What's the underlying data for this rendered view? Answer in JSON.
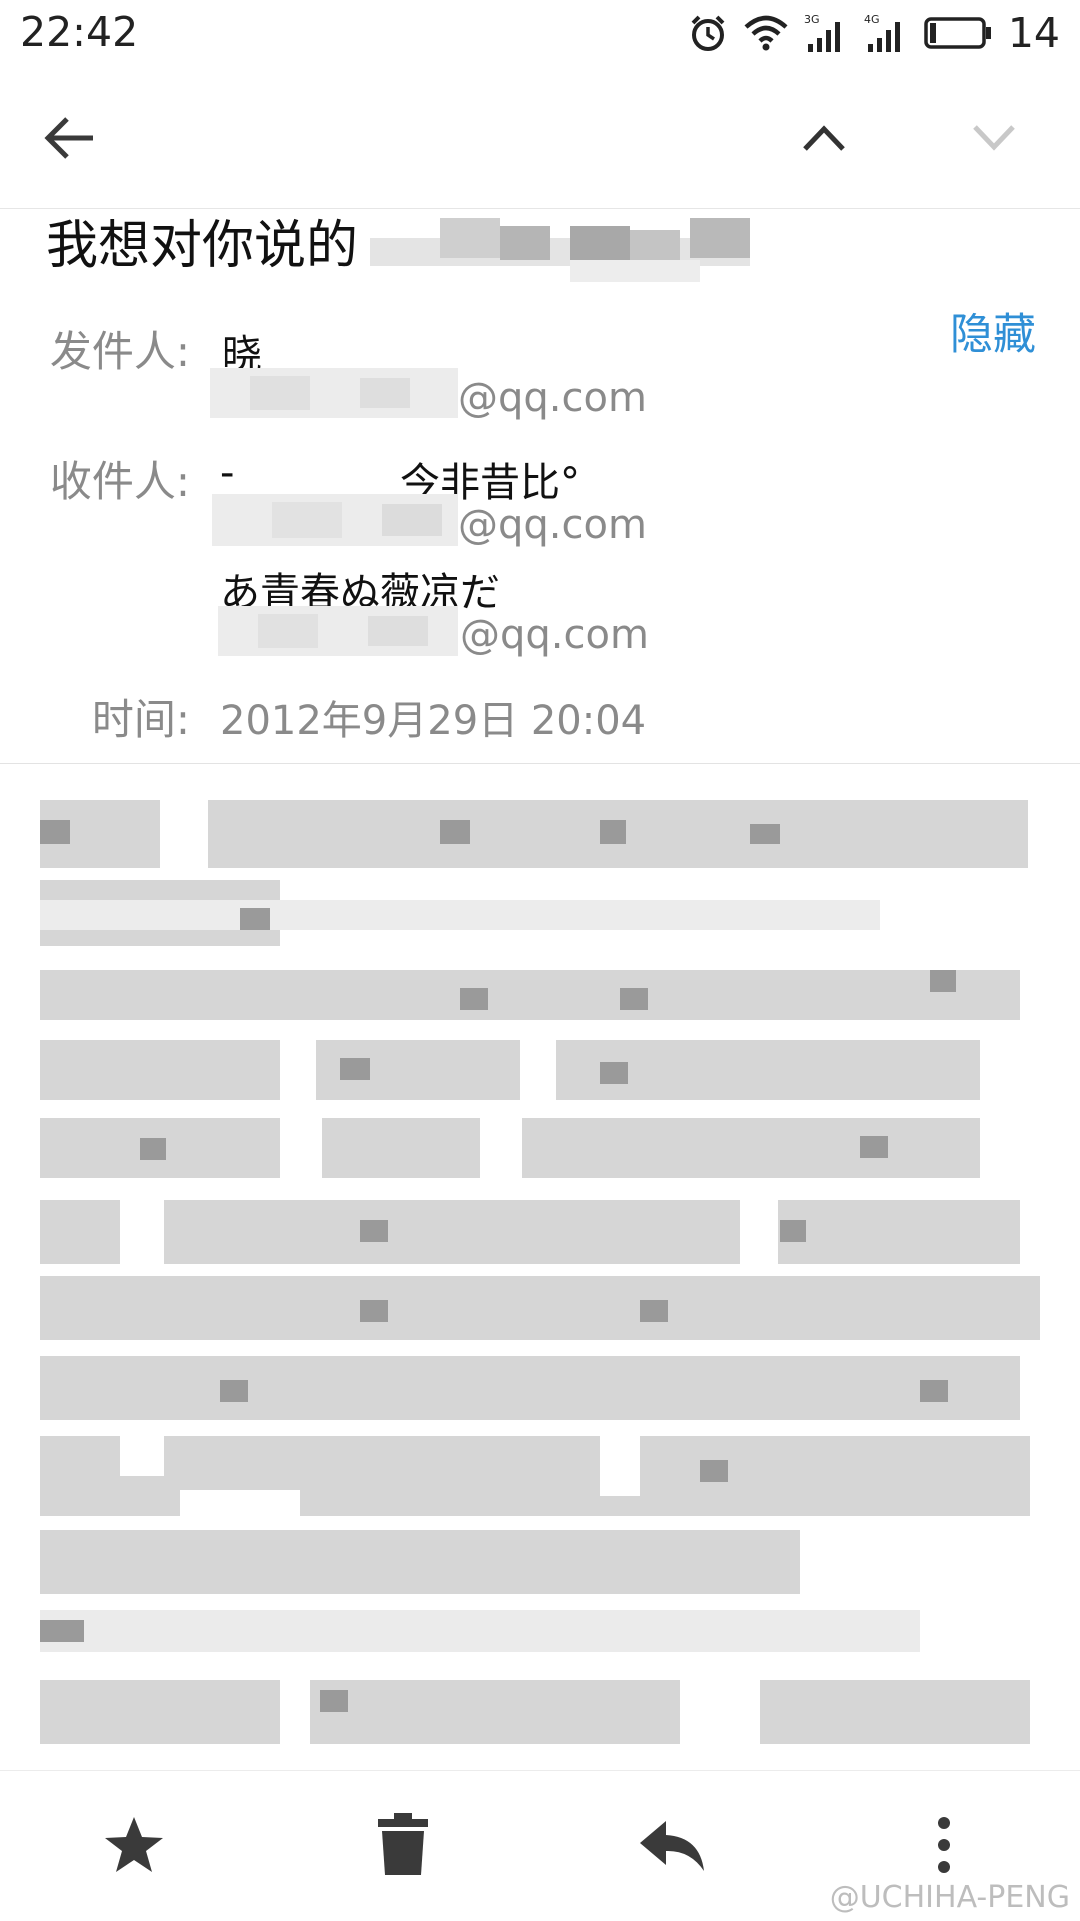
{
  "status_bar": {
    "time": "22:42",
    "icons": [
      "alarm-icon",
      "wifi-icon",
      "signal-3g-icon",
      "signal-4g-icon",
      "battery-icon"
    ],
    "signal_labels": [
      "3G",
      "4G"
    ],
    "battery_level": "14"
  },
  "toolbar": {
    "back_icon": "back-arrow-icon",
    "prev_icon": "chevron-up-icon",
    "next_icon": "chevron-down-icon"
  },
  "email": {
    "subject": "我想对你说的",
    "hide_label": "隐藏",
    "from_label": "发件人:",
    "from_name": "晓",
    "from_email_domain": "@qq.com",
    "to_label": "收件人:",
    "recipients": [
      {
        "name": "-",
        "name2": "今非昔比°",
        "email_domain": "@qq.com"
      },
      {
        "name": "あ青春ぬ薇凉だ",
        "email_domain": "@qq.com"
      }
    ],
    "time_label": "时间:",
    "time_value": "2012年9月29日 20:04"
  },
  "bottom_bar": {
    "star_icon": "star-icon",
    "delete_icon": "trash-icon",
    "reply_icon": "reply-icon",
    "more_icon": "more-vert-icon"
  },
  "watermark": "@UCHIHA-PENG",
  "colors": {
    "accent": "#2f8fd6",
    "label_gray": "#8a8a8a",
    "icon_dark": "#3a3a3a"
  }
}
